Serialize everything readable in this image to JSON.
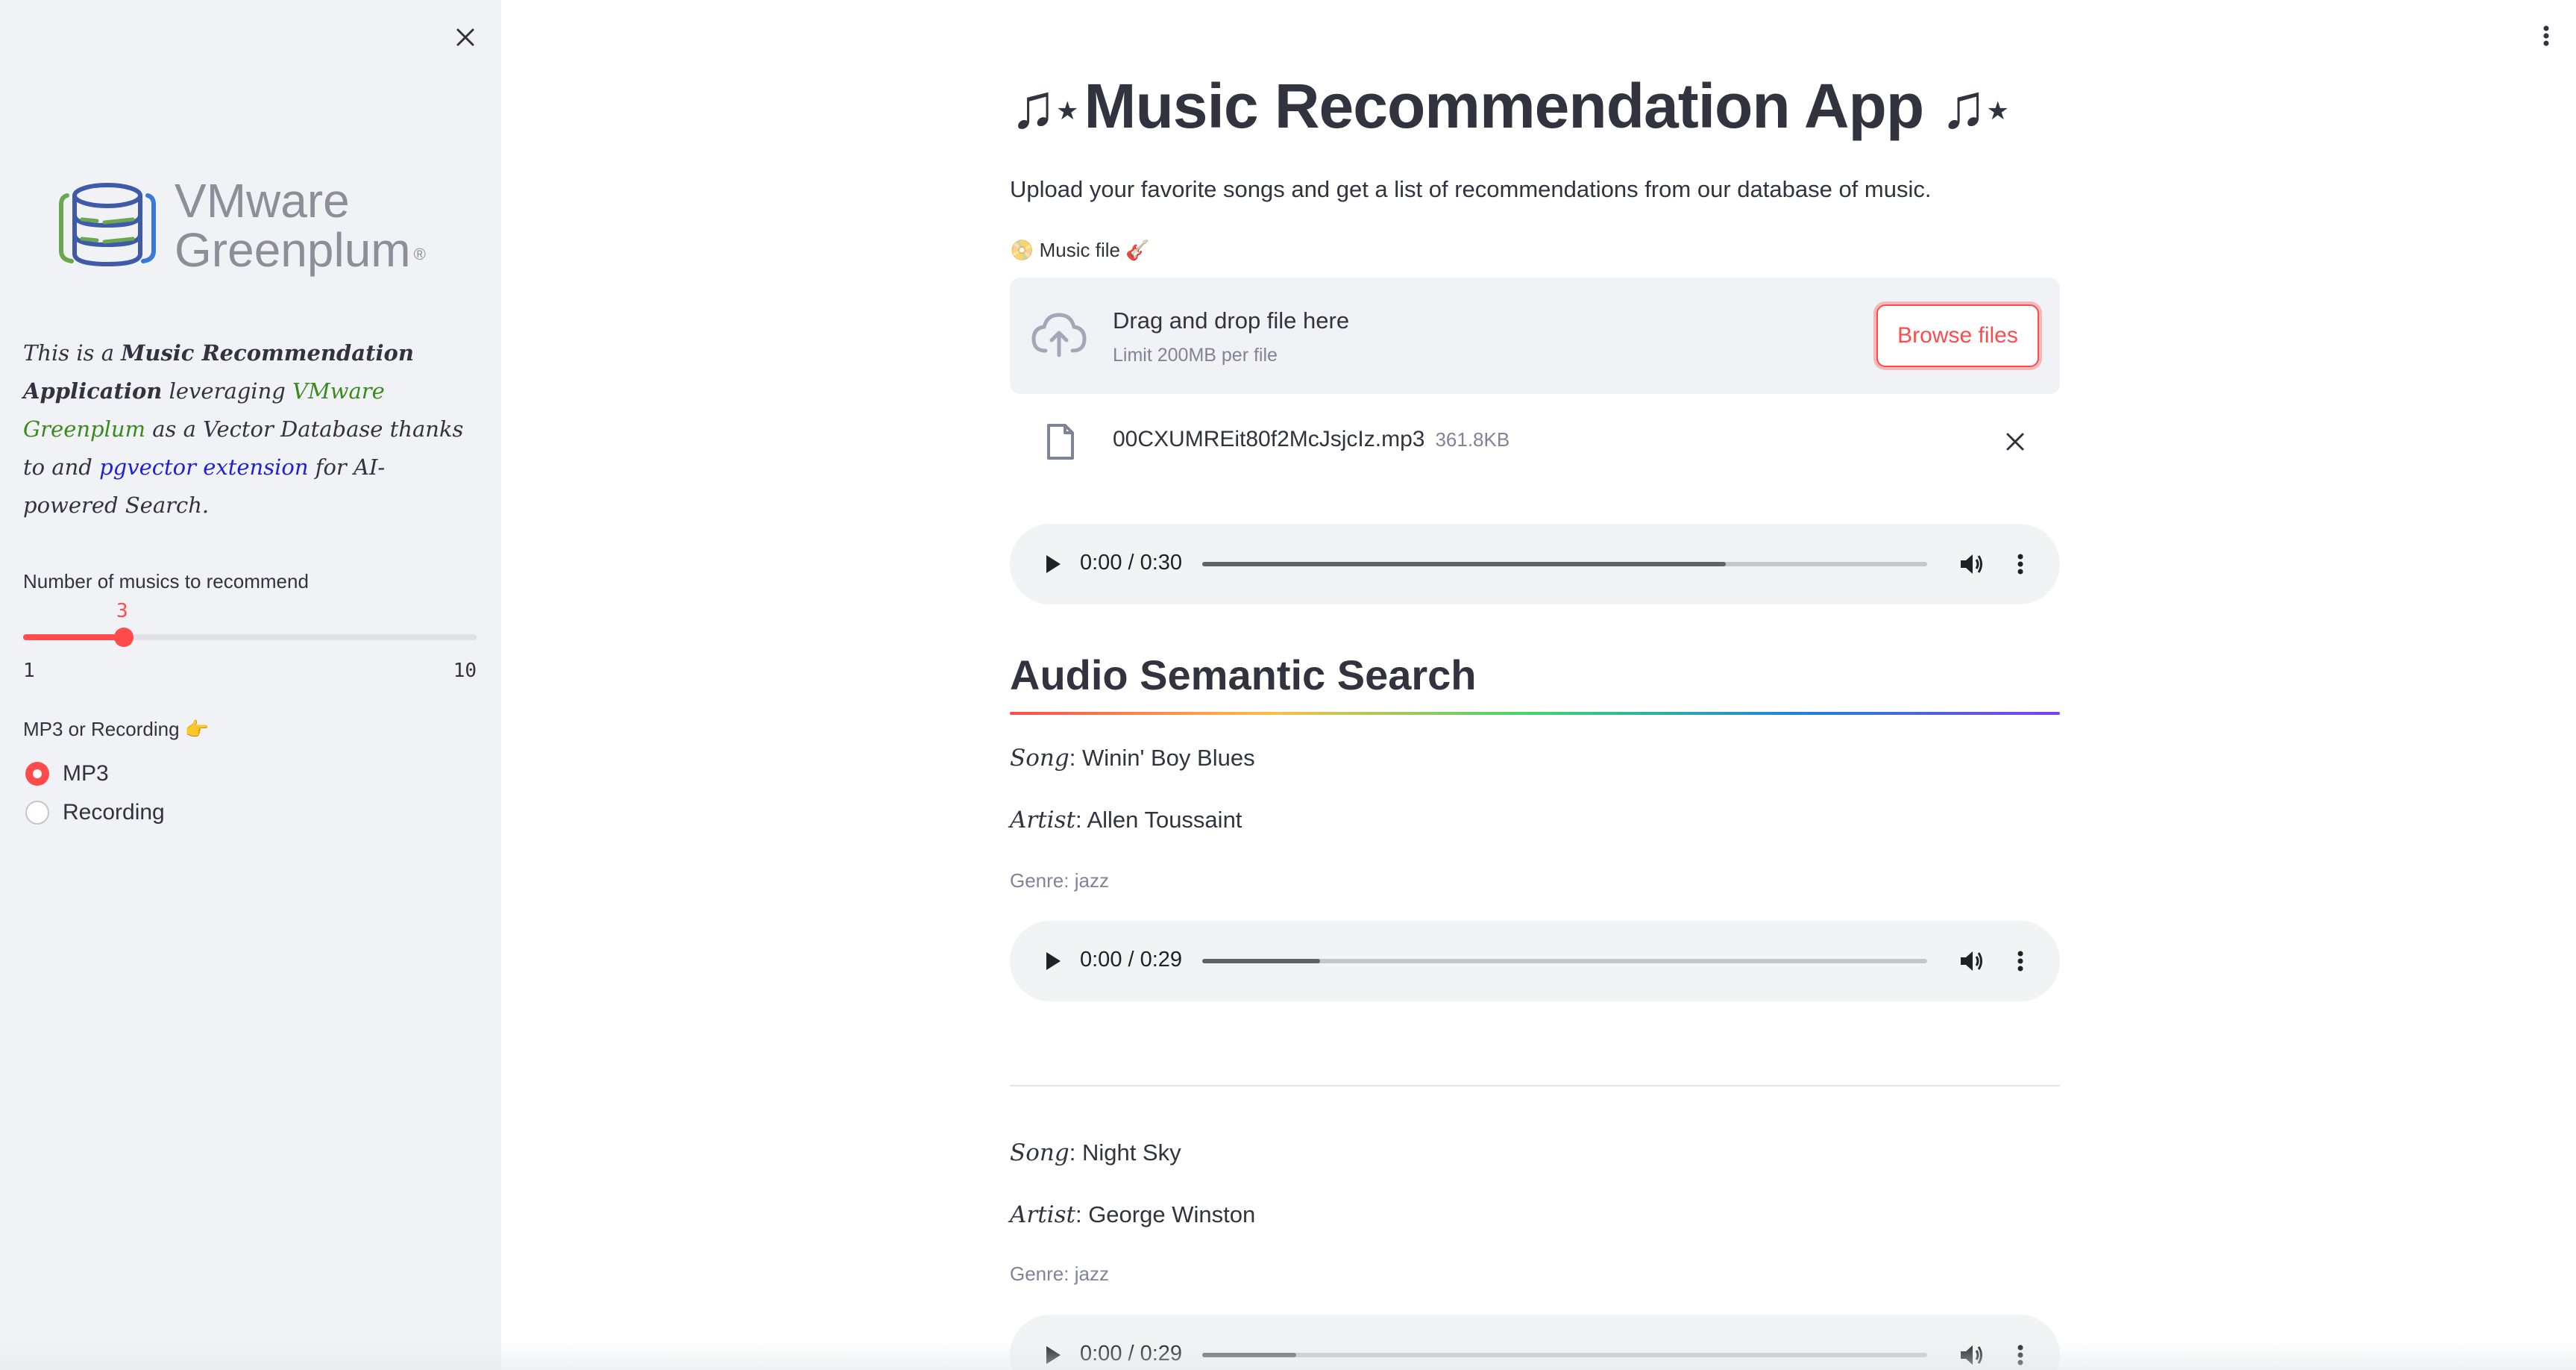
{
  "sidebar": {
    "logo": {
      "line1": "VMware",
      "line2": "Greenplum",
      "reg": "®"
    },
    "desc": {
      "p1": "This is a ",
      "app_name": "Music Recommendation Application",
      "p2": " leveraging ",
      "greenplum_link": "VMware Greenplum",
      "p3": " as a Vector Database thanks to and ",
      "pgvector_link": "pgvector extension",
      "p4": " for AI-powered Search."
    },
    "slider": {
      "label": "Number of musics to recommend",
      "value": "3",
      "min": "1",
      "max": "10"
    },
    "radio": {
      "label": "MP3 or Recording 👉",
      "options": [
        "MP3",
        "Recording"
      ],
      "selected": "MP3"
    }
  },
  "main": {
    "title": "Music Recommendation App",
    "subtitle": "Upload your favorite songs and get a list of recommendations from our database of music.",
    "file_label": "📀 Music file 🎸",
    "uploader": {
      "drag_text": "Drag and drop file here",
      "limit_text": "Limit 200MB per file",
      "browse_label": "Browse files"
    },
    "uploaded_file": {
      "name": "00CXUMREit80f2McJsjcIz.mp3",
      "size": "361.8KB"
    },
    "player_main": {
      "time": "0:00 / 0:30",
      "buffered_fraction": 0.722
    },
    "section_title": "Audio Semantic Search",
    "results": [
      {
        "song_label": "Song",
        "song": "Winin' Boy Blues",
        "artist_label": "Artist",
        "artist": "Allen Toussaint",
        "genre": "Genre: jazz",
        "time": "0:00 / 0:29",
        "buffered_fraction": 0.163
      },
      {
        "song_label": "Song",
        "song": "Night Sky",
        "artist_label": "Artist",
        "artist": "George Winston",
        "genre": "Genre: jazz",
        "time": "0:00 / 0:29",
        "buffered_fraction": 0.13
      }
    ]
  },
  "colors": {
    "accent": "#ff4b4b",
    "sidebar_bg": "#f0f2f6",
    "text": "#31333f",
    "muted": "#808495"
  },
  "icons": [
    "close-icon",
    "cloud-upload-icon",
    "file-icon",
    "play-icon",
    "volume-icon",
    "more-vert-icon"
  ]
}
